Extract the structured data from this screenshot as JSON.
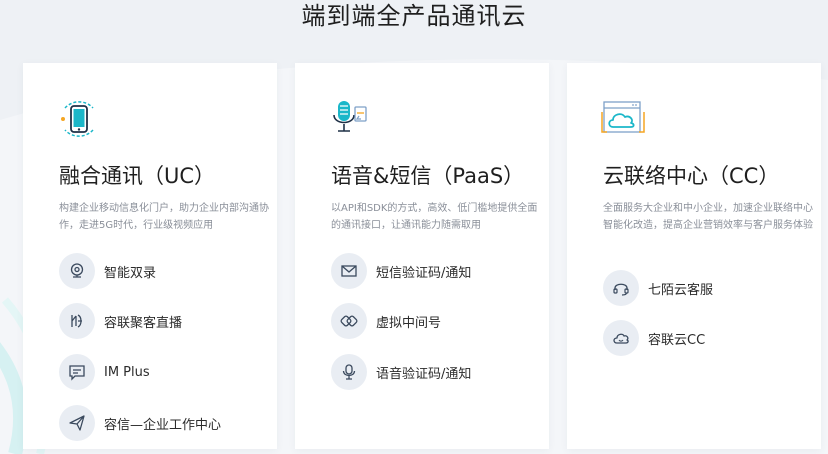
{
  "title": "端到端全产品通讯云",
  "colors": {
    "accent": "#1bb7c9",
    "icon_circle": "#e9edf3",
    "desc_text": "#8a8f99"
  },
  "cards": [
    {
      "icon": "smartphone-icon",
      "title": "融合通讯（UC）",
      "description": "构建企业移动信息化门户，助力企业内部沟通协作，走进5G时代，行业级视频应用",
      "items": [
        {
          "icon": "webcam-icon",
          "label": "智能双录"
        },
        {
          "icon": "logo-icon",
          "label": "容联聚客直播"
        },
        {
          "icon": "chat-bubble-icon",
          "label": "IM Plus"
        },
        {
          "icon": "paper-plane-icon",
          "label": "容信—企业工作中心"
        }
      ]
    },
    {
      "icon": "microphone-icon",
      "title": "语音&短信（PaaS）",
      "description": "以API和SDK的方式，高效、低门槛地提供全面的通讯接口，让通讯能力随需取用",
      "items": [
        {
          "icon": "envelope-icon",
          "label": "短信验证码/通知"
        },
        {
          "icon": "virtual-number-icon",
          "label": "虚拟中间号"
        },
        {
          "icon": "microphone-icon",
          "label": "语音验证码/通知"
        }
      ]
    },
    {
      "icon": "cloud-browser-icon",
      "title": "云联络中心（CC）",
      "description": "全面服务大企业和中小企业，加速企业联络中心智能化改造，提高企业营销效率与客户服务体验",
      "items": [
        {
          "icon": "headset-icon",
          "label": "七陌云客服"
        },
        {
          "icon": "cloud-smile-icon",
          "label": "容联云CC"
        }
      ]
    }
  ]
}
